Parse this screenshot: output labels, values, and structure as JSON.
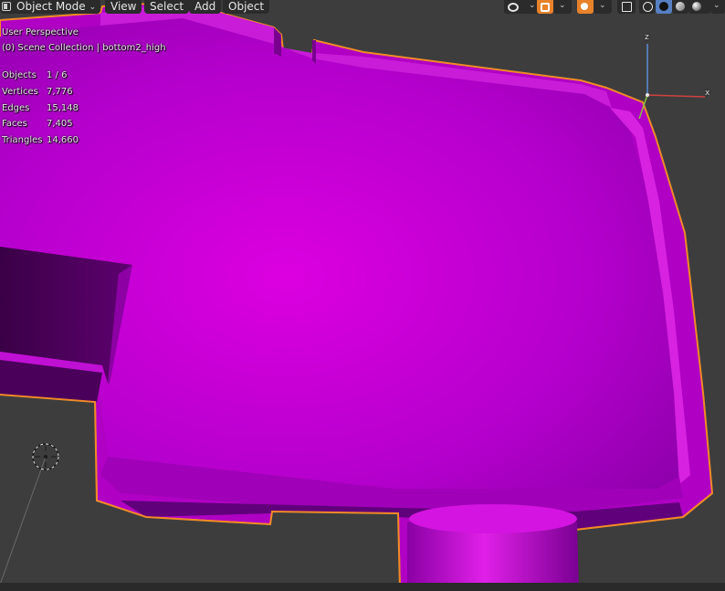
{
  "header": {
    "mode_label": "Object Mode",
    "menu": [
      "View",
      "Select",
      "Add",
      "Object"
    ]
  },
  "overlay": {
    "view_name": "User Perspective",
    "collection_path": "(0) Scene Collection | bottom2_high",
    "stats": [
      {
        "label": "Objects",
        "value": "1 / 6"
      },
      {
        "label": "Vertices",
        "value": "7,776"
      },
      {
        "label": "Edges",
        "value": "15,148"
      },
      {
        "label": "Faces",
        "value": "7,405"
      },
      {
        "label": "Triangles",
        "value": "14,660"
      }
    ]
  },
  "gizmo": {
    "x_label": "x",
    "z_label": "z",
    "x_color": "#d04040",
    "z_color": "#5a8ed6",
    "y_color": "#8cbf3f"
  },
  "icons": {
    "mode": "object-mode-icon",
    "visibility": "eye-icon",
    "gizmo_toggle": "gizmo-icon",
    "overlay_toggle": "overlay-icon",
    "xray": "xray-icon",
    "shading_wire": "wireframe-shading-icon",
    "shading_solid": "solid-shading-icon",
    "shading_material": "material-shading-icon",
    "shading_rendered": "rendered-shading-icon",
    "camera": "camera-icon"
  },
  "colors": {
    "mesh": "#cc10d8",
    "outline": "#f08a28",
    "background": "#3d3d3d",
    "accent_orange": "#e8822a",
    "active_blue": "#5680c2"
  }
}
